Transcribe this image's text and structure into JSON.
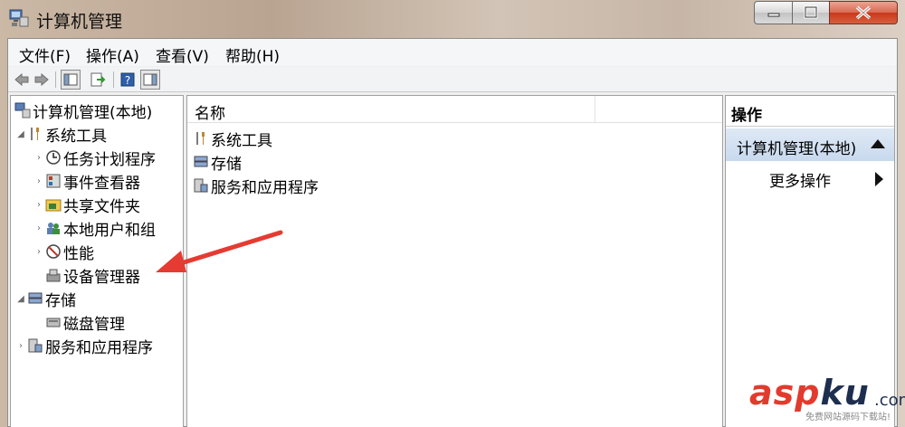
{
  "window": {
    "title": "计算机管理",
    "buttons": {
      "minimize": "minimize",
      "maximize": "maximize",
      "close": "close"
    }
  },
  "menu": [
    "文件(F)",
    "操作(A)",
    "查看(V)",
    "帮助(H)"
  ],
  "toolbar": [
    "back-icon",
    "forward-icon",
    "show-console-tree-icon",
    "export-list-icon",
    "help-icon",
    "show-action-pane-icon"
  ],
  "tree": {
    "root": "计算机管理(本地)",
    "system_tools": "系统工具",
    "task_scheduler": "任务计划程序",
    "event_viewer": "事件查看器",
    "shared_folders": "共享文件夹",
    "local_users": "本地用户和组",
    "performance": "性能",
    "device_manager": "设备管理器",
    "storage": "存储",
    "disk_management": "磁盘管理",
    "services_apps": "服务和应用程序"
  },
  "list": {
    "column_name": "名称",
    "items": [
      "系统工具",
      "存储",
      "服务和应用程序"
    ]
  },
  "actions": {
    "title": "操作",
    "section": "计算机管理(本地)",
    "more": "更多操作"
  },
  "watermark": {
    "main_red": "asp",
    "main_dark": "ku",
    "suffix": ".com",
    "sub": "免费网站源码下载站!"
  }
}
